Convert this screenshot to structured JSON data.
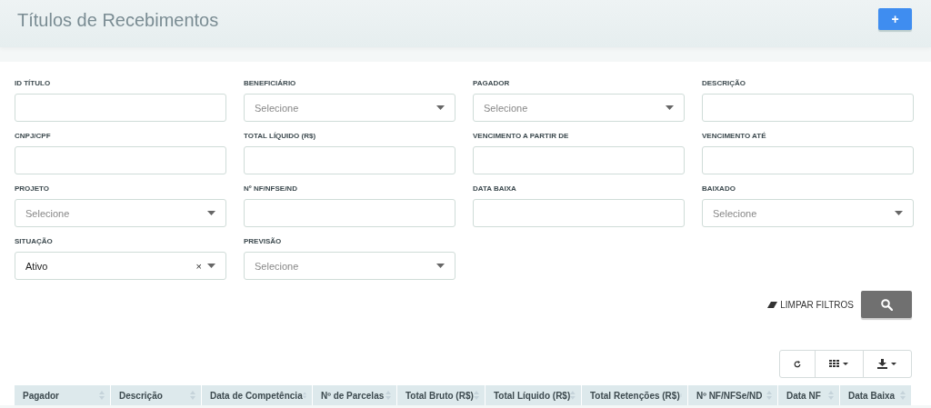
{
  "page": {
    "title": "Títulos de Recebimentos",
    "add_button": "+"
  },
  "filters": [
    {
      "kind": "text",
      "label": "ID TÍTULO"
    },
    {
      "kind": "select",
      "label": "BENEFICIÁRIO",
      "placeholder": "Selecione"
    },
    {
      "kind": "select",
      "label": "PAGADOR",
      "placeholder": "Selecione"
    },
    {
      "kind": "text",
      "label": "DESCRIÇÃO"
    },
    {
      "kind": "text",
      "label": "CNPJ/CPF"
    },
    {
      "kind": "text",
      "label": "TOTAL LÍQUIDO (R$)"
    },
    {
      "kind": "text",
      "label": "VENCIMENTO A PARTIR DE"
    },
    {
      "kind": "text",
      "label": "VENCIMENTO ATÉ"
    },
    {
      "kind": "select",
      "label": "PROJETO",
      "placeholder": "Selecione"
    },
    {
      "kind": "text",
      "label": "Nº NF/NFSE/ND"
    },
    {
      "kind": "text",
      "label": "DATA BAIXA"
    },
    {
      "kind": "select",
      "label": "BAIXADO",
      "placeholder": "Selecione"
    },
    {
      "kind": "select",
      "label": "SITUAÇÃO",
      "value": "Ativo",
      "clear": "×"
    },
    {
      "kind": "select",
      "label": "PREVISÃO",
      "placeholder": "Selecione"
    }
  ],
  "clear_filters": "LIMPAR FILTROS",
  "table": {
    "columns": [
      "Pagador",
      "Descrição",
      "Data de Competência",
      "Nº de Parcelas",
      "Total Bruto (R$)",
      "Total Líquido (R$)",
      "Total Retenções (R$)",
      "Nº NF/NFSe/ND",
      "Data NF",
      "Data Baixa"
    ]
  }
}
